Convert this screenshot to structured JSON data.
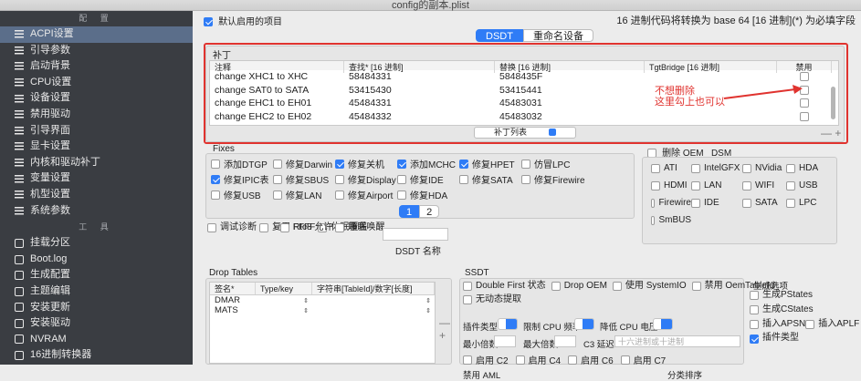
{
  "window": {
    "title": "config的副本.plist"
  },
  "sidebar": {
    "config_header": "配 置",
    "items": [
      {
        "label": "ACPI设置",
        "active": true
      },
      {
        "label": "引导参数"
      },
      {
        "label": "启动背景"
      },
      {
        "label": "CPU设置"
      },
      {
        "label": "设备设置"
      },
      {
        "label": "禁用驱动"
      },
      {
        "label": "引导界面"
      },
      {
        "label": "显卡设置"
      },
      {
        "label": "内核和驱动补丁"
      },
      {
        "label": "变量设置"
      },
      {
        "label": "机型设置"
      },
      {
        "label": "系统参数"
      }
    ],
    "tools_header": "工 具",
    "tools": [
      {
        "label": "挂载分区"
      },
      {
        "label": "Boot.log"
      },
      {
        "label": "生成配置"
      },
      {
        "label": "主题编辑"
      },
      {
        "label": "安装更新"
      },
      {
        "label": "安装驱动"
      },
      {
        "label": "NVRAM"
      },
      {
        "label": "16进制转换器"
      }
    ]
  },
  "top": {
    "default_enabled": "默认启用的项目",
    "hex_note": "16 进制代码将转换为 base 64 [16 进制](*) 为必填字段"
  },
  "tabs": {
    "dsdt": "DSDT",
    "rename": "重命名设备"
  },
  "patches": {
    "section_label": "补丁",
    "columns": [
      "注释",
      "查找* [16 进制]",
      "替换 [16 进制]",
      "TgtBridge [16 进制]",
      "禁用"
    ],
    "rows": [
      {
        "comment": "change XHC1 to XHC",
        "find": "58484331",
        "replace": "5848435F"
      },
      {
        "comment": "change SAT0 to SATA",
        "find": "53415430",
        "replace": "53415441"
      },
      {
        "comment": "change EHC1 to EH01",
        "find": "45484331",
        "replace": "45483031"
      },
      {
        "comment": "change EHC2 to EH02",
        "find": "45484332",
        "replace": "45483032"
      }
    ],
    "list_button": "补丁列表",
    "annotation_line1": "不想删除",
    "annotation_line2": "这里勾上也可以"
  },
  "fixes": {
    "label": "Fixes",
    "items": [
      {
        "label": "添加DTGP",
        "on": false
      },
      {
        "label": "修复Darwin",
        "on": false
      },
      {
        "label": "修复关机",
        "on": true
      },
      {
        "label": "添加MCHC",
        "on": true
      },
      {
        "label": "修复HPET",
        "on": true
      },
      {
        "label": "仿冒LPC",
        "on": false
      },
      {
        "label": "修复IPIC表",
        "on": true
      },
      {
        "label": "修复SBUS",
        "on": false
      },
      {
        "label": "修复Display",
        "on": false
      },
      {
        "label": "修复IDE",
        "on": false
      },
      {
        "label": "修复SATA",
        "on": false
      },
      {
        "label": "修复Firewire",
        "on": false
      },
      {
        "label": "修复USB",
        "on": false
      },
      {
        "label": "修复LAN",
        "on": false
      },
      {
        "label": "修复Airport",
        "on": false
      },
      {
        "label": "修复HDA",
        "on": false
      }
    ],
    "pages": [
      "1",
      "2"
    ]
  },
  "oem": {
    "delete_label": "删除 OEM _DSM",
    "items": [
      "ATI",
      "IntelGFX",
      "NVidia",
      "HDA",
      "HDMI",
      "LAN",
      "WIFI",
      "USB",
      "Firewire",
      "IDE",
      "SATA",
      "LPC",
      "SmBUS"
    ]
  },
  "misc": {
    "debug": "调试诊断",
    "rtc8": "Rtc8 允许",
    "reuse_ffff": "复用 FFFF",
    "sleep_wake": "睡眠唤醒",
    "hibernate": "休眠覆盖",
    "dsdt_name_label": "DSDT 名称"
  },
  "drop_tables": {
    "label": "Drop Tables",
    "columns": [
      "签名*",
      "Type/key",
      "字符串[TableId]/数字[长度]"
    ],
    "rows": [
      "DMAR",
      "MATS"
    ]
  },
  "ssdt": {
    "label": "SSDT",
    "double_first": "Double First 状态",
    "drop_oem": "Drop OEM",
    "use_systemio": "使用 SystemIO",
    "disable_oemtableid": "禁用 OemTableId",
    "no_extract": "无动态提取",
    "plugin_type": "插件类型",
    "limit_cpu": "限制 CPU 频率",
    "lower_cpu": "降低 CPU 电压",
    "min_multi": "最小倍数",
    "max_multi": "最大倍数",
    "c3_latency": "C3 延迟",
    "hex_placeholder": "十六进制或十进制",
    "c_states": [
      "启用 C2",
      "启用 C4",
      "启用 C6",
      "启用 C7"
    ],
    "gen_label": "生成选项",
    "gen_items": [
      {
        "label": "生成PStates",
        "on": false
      },
      {
        "label": "生成CStates",
        "on": false
      },
      {
        "label": "插入APSN",
        "on": false
      },
      {
        "label": "插入APLF",
        "on": false
      },
      {
        "label": "插件类型",
        "on": true
      }
    ],
    "disable_aml": "禁用 AML",
    "sort_order": "分类排序"
  }
}
